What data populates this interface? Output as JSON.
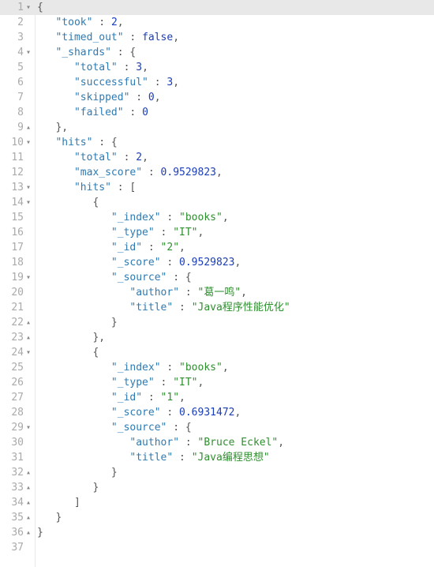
{
  "response": {
    "took": 2,
    "timed_out": false,
    "_shards": {
      "total": 3,
      "successful": 3,
      "skipped": 0,
      "failed": 0
    },
    "hits": {
      "total": 2,
      "max_score": 0.9529823,
      "hits": [
        {
          "_index": "books",
          "_type": "IT",
          "_id": "2",
          "_score": 0.9529823,
          "_source": {
            "author": "葛一鸣",
            "title": "Java程序性能优化"
          }
        },
        {
          "_index": "books",
          "_type": "IT",
          "_id": "1",
          "_score": 0.6931472,
          "_source": {
            "author": "Bruce Eckel",
            "title": "Java编程思想"
          }
        }
      ]
    }
  },
  "lines": [
    {
      "n": "1",
      "f": "▾",
      "hl": true,
      "t": [
        {
          "c": "punct",
          "v": "{"
        }
      ]
    },
    {
      "n": "2",
      "f": "",
      "t": [
        {
          "c": "",
          "v": "   "
        },
        {
          "c": "key",
          "v": "\"took\""
        },
        {
          "c": "punct",
          "v": " : "
        },
        {
          "c": "num",
          "v": "2"
        },
        {
          "c": "punct",
          "v": ","
        }
      ]
    },
    {
      "n": "3",
      "f": "",
      "t": [
        {
          "c": "",
          "v": "   "
        },
        {
          "c": "key",
          "v": "\"timed_out\""
        },
        {
          "c": "punct",
          "v": " : "
        },
        {
          "c": "bool",
          "v": "false"
        },
        {
          "c": "punct",
          "v": ","
        }
      ]
    },
    {
      "n": "4",
      "f": "▾",
      "t": [
        {
          "c": "",
          "v": "   "
        },
        {
          "c": "key",
          "v": "\"_shards\""
        },
        {
          "c": "punct",
          "v": " : {"
        }
      ]
    },
    {
      "n": "5",
      "f": "",
      "t": [
        {
          "c": "",
          "v": "      "
        },
        {
          "c": "key",
          "v": "\"total\""
        },
        {
          "c": "punct",
          "v": " : "
        },
        {
          "c": "num",
          "v": "3"
        },
        {
          "c": "punct",
          "v": ","
        }
      ]
    },
    {
      "n": "6",
      "f": "",
      "t": [
        {
          "c": "",
          "v": "      "
        },
        {
          "c": "key",
          "v": "\"successful\""
        },
        {
          "c": "punct",
          "v": " : "
        },
        {
          "c": "num",
          "v": "3"
        },
        {
          "c": "punct",
          "v": ","
        }
      ]
    },
    {
      "n": "7",
      "f": "",
      "t": [
        {
          "c": "",
          "v": "      "
        },
        {
          "c": "key",
          "v": "\"skipped\""
        },
        {
          "c": "punct",
          "v": " : "
        },
        {
          "c": "num",
          "v": "0"
        },
        {
          "c": "punct",
          "v": ","
        }
      ]
    },
    {
      "n": "8",
      "f": "",
      "t": [
        {
          "c": "",
          "v": "      "
        },
        {
          "c": "key",
          "v": "\"failed\""
        },
        {
          "c": "punct",
          "v": " : "
        },
        {
          "c": "num",
          "v": "0"
        }
      ]
    },
    {
      "n": "9",
      "f": "▴",
      "t": [
        {
          "c": "",
          "v": "   "
        },
        {
          "c": "punct",
          "v": "},"
        }
      ]
    },
    {
      "n": "10",
      "f": "▾",
      "t": [
        {
          "c": "",
          "v": "   "
        },
        {
          "c": "key",
          "v": "\"hits\""
        },
        {
          "c": "punct",
          "v": " : {"
        }
      ]
    },
    {
      "n": "11",
      "f": "",
      "t": [
        {
          "c": "",
          "v": "      "
        },
        {
          "c": "key",
          "v": "\"total\""
        },
        {
          "c": "punct",
          "v": " : "
        },
        {
          "c": "num",
          "v": "2"
        },
        {
          "c": "punct",
          "v": ","
        }
      ]
    },
    {
      "n": "12",
      "f": "",
      "t": [
        {
          "c": "",
          "v": "      "
        },
        {
          "c": "key",
          "v": "\"max_score\""
        },
        {
          "c": "punct",
          "v": " : "
        },
        {
          "c": "num",
          "v": "0.9529823"
        },
        {
          "c": "punct",
          "v": ","
        }
      ]
    },
    {
      "n": "13",
      "f": "▾",
      "t": [
        {
          "c": "",
          "v": "      "
        },
        {
          "c": "key",
          "v": "\"hits\""
        },
        {
          "c": "punct",
          "v": " : ["
        }
      ]
    },
    {
      "n": "14",
      "f": "▾",
      "t": [
        {
          "c": "",
          "v": "         "
        },
        {
          "c": "punct",
          "v": "{"
        }
      ]
    },
    {
      "n": "15",
      "f": "",
      "t": [
        {
          "c": "",
          "v": "            "
        },
        {
          "c": "key",
          "v": "\"_index\""
        },
        {
          "c": "punct",
          "v": " : "
        },
        {
          "c": "str",
          "v": "\"books\""
        },
        {
          "c": "punct",
          "v": ","
        }
      ]
    },
    {
      "n": "16",
      "f": "",
      "t": [
        {
          "c": "",
          "v": "            "
        },
        {
          "c": "key",
          "v": "\"_type\""
        },
        {
          "c": "punct",
          "v": " : "
        },
        {
          "c": "str",
          "v": "\"IT\""
        },
        {
          "c": "punct",
          "v": ","
        }
      ]
    },
    {
      "n": "17",
      "f": "",
      "t": [
        {
          "c": "",
          "v": "            "
        },
        {
          "c": "key",
          "v": "\"_id\""
        },
        {
          "c": "punct",
          "v": " : "
        },
        {
          "c": "str",
          "v": "\"2\""
        },
        {
          "c": "punct",
          "v": ","
        }
      ]
    },
    {
      "n": "18",
      "f": "",
      "t": [
        {
          "c": "",
          "v": "            "
        },
        {
          "c": "key",
          "v": "\"_score\""
        },
        {
          "c": "punct",
          "v": " : "
        },
        {
          "c": "num",
          "v": "0.9529823"
        },
        {
          "c": "punct",
          "v": ","
        }
      ]
    },
    {
      "n": "19",
      "f": "▾",
      "t": [
        {
          "c": "",
          "v": "            "
        },
        {
          "c": "key",
          "v": "\"_source\""
        },
        {
          "c": "punct",
          "v": " : {"
        }
      ]
    },
    {
      "n": "20",
      "f": "",
      "t": [
        {
          "c": "",
          "v": "               "
        },
        {
          "c": "key",
          "v": "\"author\""
        },
        {
          "c": "punct",
          "v": " : "
        },
        {
          "c": "str",
          "v": "\"葛一鸣\""
        },
        {
          "c": "punct",
          "v": ","
        }
      ]
    },
    {
      "n": "21",
      "f": "",
      "t": [
        {
          "c": "",
          "v": "               "
        },
        {
          "c": "key",
          "v": "\"title\""
        },
        {
          "c": "punct",
          "v": " : "
        },
        {
          "c": "str",
          "v": "\"Java程序性能优化\""
        }
      ]
    },
    {
      "n": "22",
      "f": "▴",
      "t": [
        {
          "c": "",
          "v": "            "
        },
        {
          "c": "punct",
          "v": "}"
        }
      ]
    },
    {
      "n": "23",
      "f": "▴",
      "t": [
        {
          "c": "",
          "v": "         "
        },
        {
          "c": "punct",
          "v": "},"
        }
      ]
    },
    {
      "n": "24",
      "f": "▾",
      "t": [
        {
          "c": "",
          "v": "         "
        },
        {
          "c": "punct",
          "v": "{"
        }
      ]
    },
    {
      "n": "25",
      "f": "",
      "t": [
        {
          "c": "",
          "v": "            "
        },
        {
          "c": "key",
          "v": "\"_index\""
        },
        {
          "c": "punct",
          "v": " : "
        },
        {
          "c": "str",
          "v": "\"books\""
        },
        {
          "c": "punct",
          "v": ","
        }
      ]
    },
    {
      "n": "26",
      "f": "",
      "t": [
        {
          "c": "",
          "v": "            "
        },
        {
          "c": "key",
          "v": "\"_type\""
        },
        {
          "c": "punct",
          "v": " : "
        },
        {
          "c": "str",
          "v": "\"IT\""
        },
        {
          "c": "punct",
          "v": ","
        }
      ]
    },
    {
      "n": "27",
      "f": "",
      "t": [
        {
          "c": "",
          "v": "            "
        },
        {
          "c": "key",
          "v": "\"_id\""
        },
        {
          "c": "punct",
          "v": " : "
        },
        {
          "c": "str",
          "v": "\"1\""
        },
        {
          "c": "punct",
          "v": ","
        }
      ]
    },
    {
      "n": "28",
      "f": "",
      "t": [
        {
          "c": "",
          "v": "            "
        },
        {
          "c": "key",
          "v": "\"_score\""
        },
        {
          "c": "punct",
          "v": " : "
        },
        {
          "c": "num",
          "v": "0.6931472"
        },
        {
          "c": "punct",
          "v": ","
        }
      ]
    },
    {
      "n": "29",
      "f": "▾",
      "t": [
        {
          "c": "",
          "v": "            "
        },
        {
          "c": "key",
          "v": "\"_source\""
        },
        {
          "c": "punct",
          "v": " : {"
        }
      ]
    },
    {
      "n": "30",
      "f": "",
      "t": [
        {
          "c": "",
          "v": "               "
        },
        {
          "c": "key",
          "v": "\"author\""
        },
        {
          "c": "punct",
          "v": " : "
        },
        {
          "c": "str",
          "v": "\"Bruce Eckel\""
        },
        {
          "c": "punct",
          "v": ","
        }
      ]
    },
    {
      "n": "31",
      "f": "",
      "t": [
        {
          "c": "",
          "v": "               "
        },
        {
          "c": "key",
          "v": "\"title\""
        },
        {
          "c": "punct",
          "v": " : "
        },
        {
          "c": "str",
          "v": "\"Java编程思想\""
        }
      ]
    },
    {
      "n": "32",
      "f": "▴",
      "t": [
        {
          "c": "",
          "v": "            "
        },
        {
          "c": "punct",
          "v": "}"
        }
      ]
    },
    {
      "n": "33",
      "f": "▴",
      "t": [
        {
          "c": "",
          "v": "         "
        },
        {
          "c": "punct",
          "v": "}"
        }
      ]
    },
    {
      "n": "34",
      "f": "▴",
      "t": [
        {
          "c": "",
          "v": "      "
        },
        {
          "c": "punct",
          "v": "]"
        }
      ]
    },
    {
      "n": "35",
      "f": "▴",
      "t": [
        {
          "c": "",
          "v": "   "
        },
        {
          "c": "punct",
          "v": "}"
        }
      ]
    },
    {
      "n": "36",
      "f": "▴",
      "t": [
        {
          "c": "punct",
          "v": "}"
        }
      ]
    },
    {
      "n": "37",
      "f": "",
      "t": []
    }
  ]
}
